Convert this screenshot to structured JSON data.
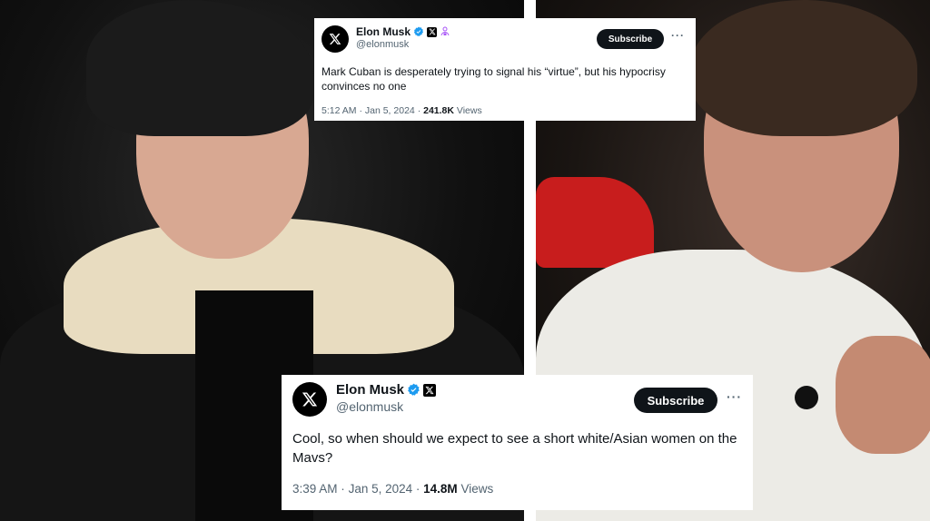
{
  "tweets": {
    "top": {
      "author_name": "Elon Musk",
      "handle": "@elonmusk",
      "subscribe_label": "Subscribe",
      "more_label": "···",
      "text": "Mark Cuban is desperately trying to signal his “virtue”, but his hypocrisy convinces no one",
      "time": "5:12 AM",
      "date": "Jan 5, 2024",
      "separator": "·",
      "views_count": "241.8K",
      "views_label": "Views",
      "badges": [
        "verified-icon",
        "x-badge-icon",
        "affiliate-icon"
      ]
    },
    "bottom": {
      "author_name": "Elon Musk",
      "handle": "@elonmusk",
      "subscribe_label": "Subscribe",
      "more_label": "···",
      "text": "Cool, so when should we expect to see a short white/Asian women on the Mavs?",
      "time": "3:39 AM",
      "date": "Jan 5, 2024",
      "separator": "·",
      "views_count": "14.8M",
      "views_label": "Views",
      "badges": [
        "verified-icon",
        "x-badge-icon"
      ]
    }
  },
  "colors": {
    "verified_blue": "#1d9bf0",
    "affiliate_purple": "#a855f7",
    "text_primary": "#0f1419",
    "text_secondary": "#536471",
    "button_dark": "#0f1419"
  },
  "images": {
    "left": "photo-of-elon-musk",
    "right": "photo-of-mark-cuban"
  }
}
